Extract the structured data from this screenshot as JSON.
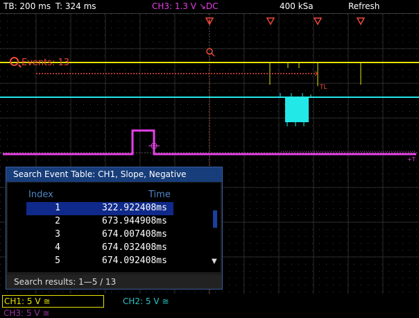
{
  "status_bar": {
    "timebase": "TB: 200 ms",
    "trigger_time": "T: 324 ms",
    "trigger_source": "CH3: 1.3 V ↘DC",
    "sample_rate": "400 kSa",
    "refresh": "Refresh"
  },
  "overlay": {
    "events_label": "Events: 13",
    "threshold_label": "TL",
    "ch3_marker": "+T"
  },
  "search_table": {
    "title": "Search Event Table: CH1, Slope, Negative",
    "columns": [
      "Index",
      "Time"
    ],
    "rows": [
      {
        "index": "1",
        "time": "322.922408ms"
      },
      {
        "index": "2",
        "time": "673.944908ms"
      },
      {
        "index": "3",
        "time": "674.007408ms"
      },
      {
        "index": "4",
        "time": "674.032408ms"
      },
      {
        "index": "5",
        "time": "674.092408ms"
      }
    ],
    "selected_index": "1",
    "results": "Search results: 1—5 / 13"
  },
  "channels": {
    "ch1": "CH1: 5 V ≅",
    "ch2": "CH2: 5 V ≅",
    "ch3": "CH3: 5 V ≅"
  },
  "colors": {
    "ch1": "#e6e600",
    "ch2": "#22e8e8",
    "ch3": "#e640e6",
    "search": "#f04a3a",
    "panel_header": "#173d7a",
    "selected_row": "#0f2a8a"
  },
  "icons": [
    "magnifier-icon",
    "search-marker-icon",
    "trigger-marker-icon",
    "scroll-down-icon"
  ]
}
